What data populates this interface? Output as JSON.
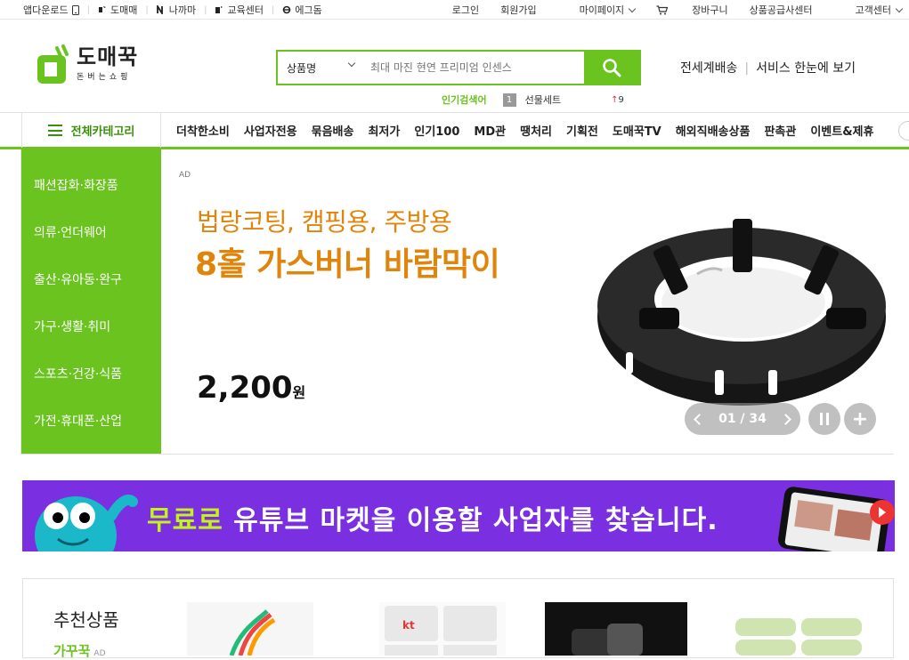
{
  "topbar": {
    "left": [
      {
        "label": "앱다운로드",
        "icon": "phone-icon"
      },
      {
        "label": "도매매",
        "icon": "domeme-logo-icon"
      },
      {
        "label": "나까마",
        "icon": "nakama-logo-icon"
      },
      {
        "label": "교육센터",
        "icon": "edu-logo-icon"
      },
      {
        "label": "에그돔",
        "icon": "eggdome-logo-icon"
      }
    ],
    "right": {
      "login": "로그인",
      "signup": "회원가입",
      "mypage": "마이페이지",
      "cart": "장바구니",
      "supplier": "상품공급사센터",
      "support": "고객센터"
    }
  },
  "logo": {
    "main": "도매꾹",
    "sub": "돈버는쇼핑"
  },
  "search": {
    "category": "상품명",
    "placeholder": "최대 마진 현연 프리미엄 인센스"
  },
  "popular": {
    "label": "인기검색어",
    "rank": "1",
    "keyword": "선물세트",
    "trend": "9"
  },
  "header_right": {
    "global": "전세계배송",
    "services": "서비스 한눈에 보기"
  },
  "nav": {
    "all_categories": "전체카테고리",
    "menu": [
      "더착한소비",
      "사업자전용",
      "묶음배송",
      "최저가",
      "인기100",
      "MD관",
      "땡처리",
      "기획전",
      "도매꾹TV",
      "해외직배송상품",
      "판촉관",
      "이벤트&제휴"
    ]
  },
  "side_categories": [
    "패션잡화·화장품",
    "의류·언더웨어",
    "출산·유아동·완구",
    "가구·생활·취미",
    "스포츠·건강·식품",
    "가전·휴대폰·산업"
  ],
  "banner": {
    "ad": "AD",
    "headline1": "법랑코팅, 캠핑용, 주방용",
    "headline2": "8홀 가스버너 바람막이",
    "price": "2,200",
    "currency": "원",
    "pager": "01 / 34"
  },
  "promo": {
    "highlight": "무료로",
    "text": " 유튜브 마켓을 이용할 사업자를 찾습니다."
  },
  "recommend": {
    "title": "추천상품",
    "sub": "가꾸꾹",
    "ad": "AD"
  },
  "colors": {
    "brand": "#6ac31f",
    "accent_orange": "#e0850c",
    "promo_bg": "#7a2fe0"
  }
}
